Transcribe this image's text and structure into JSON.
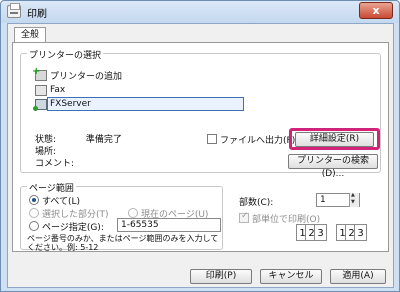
{
  "window": {
    "title": "印刷",
    "close": "x"
  },
  "tabs": [
    "全般"
  ],
  "printer_select": {
    "label": "プリンターの選択",
    "items": [
      {
        "label": "プリンターの追加",
        "icon": "printer-add-icon"
      },
      {
        "label": "Fax",
        "icon": "fax-icon"
      },
      {
        "label": "FXServer",
        "icon": "network-printer-icon",
        "selected": true
      }
    ]
  },
  "status": {
    "state_label": "状態:",
    "state_value": "準備完了",
    "location_label": "場所:",
    "location_value": "",
    "comment_label": "コメント:",
    "comment_value": ""
  },
  "print_to_file": "ファイルへ出力(F)",
  "buttons": {
    "advanced": "詳細設定(R)",
    "find_printer": "プリンターの検索(D)...",
    "print": "印刷(P)",
    "cancel": "キャンセル",
    "apply": "適用(A)"
  },
  "page_range": {
    "label": "ページ範囲",
    "all": "すべて(L)",
    "selection": "選択した部分(T)",
    "current_page": "現在のページ(U)",
    "pages": "ページ指定(G):",
    "pages_value": "1-65535",
    "hint": "ページ番号のみか、またはページ範囲のみを入力して\nください。例: 5-12"
  },
  "copies": {
    "label": "部数(C):",
    "value": "1",
    "collate": "部単位で印刷(O)",
    "collate_checked": true,
    "collate_pages": [
      "1",
      "2",
      "3"
    ]
  },
  "colors": {
    "highlight": "#d2237a",
    "window_frame": "#cfe0f3"
  }
}
